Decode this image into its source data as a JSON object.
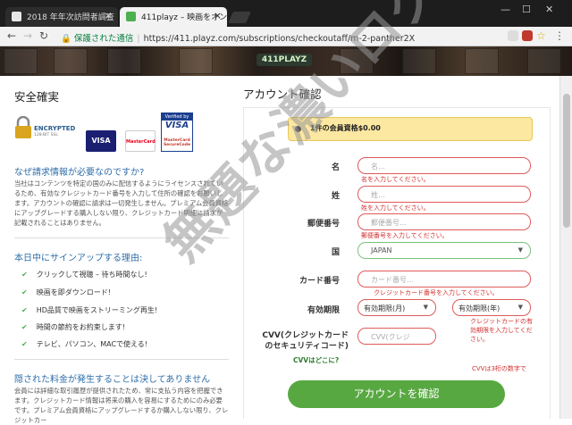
{
  "browser": {
    "tabs": [
      {
        "label": "2018 年年次訪問者調査"
      },
      {
        "label": "411playz – 映画をオンライン"
      }
    ],
    "address": {
      "secure_label": "保護された通信",
      "url": "https://411.playz.com/subscriptions/checkoutaff/m-2-panther2X"
    }
  },
  "site": {
    "logo": "411PLAYZ"
  },
  "left": {
    "security_heading": "安全確実",
    "badges": {
      "encrypted": "ENCRYPTED",
      "encrypted_sub": "128-BIT SSL",
      "visa": "VISA",
      "mastercard": "MasterCard",
      "verified_title": "Verified by",
      "verified_brand": "VISA",
      "securecode": "MasterCard SecureCode"
    },
    "why_heading": "なぜ請求情報が必要なのですか?",
    "why_text": "当社はコンテンツを特定の国のみに配信するようにライセンスされているため、有効なクレジットカード番号を入力して住所の確認をお願いします。アカウントの確認に請求は一切発生しません。プレミアム会員資格にアップグレードする購入しない限り、クレジットカード明細に請求が記載されることはありません。",
    "signup_heading": "本日中にサインアップする理由:",
    "features": [
      "クリックして視聴 – 待ち時間なし!",
      "映画を即ダウンロード!",
      "HD品質で映画をストリーミング再生!",
      "時間の節約をお約束します!",
      "テレビ、パソコン、MACで使える!"
    ],
    "hidden_heading": "隠された料金が発生することは決してありません",
    "hidden_text": "会員には詳細な取引履歴が提供されたため、常に支払う内容を把握できます。クレジットカード情報は将来の購入を容易にするためにのみ必要です。プレミアム会員資格にアップグレードするか購入しない限り、クレジットカー"
  },
  "form": {
    "heading": "アカウント確認",
    "plan_label": "1件の会員資格$0.00",
    "fields": {
      "first_name": {
        "label": "名",
        "placeholder": "名…",
        "error": "名を入力してください。"
      },
      "last_name": {
        "label": "姓",
        "placeholder": "姓…",
        "error": "姓を入力してください。"
      },
      "zip": {
        "label": "郵便番号",
        "placeholder": "郵便番号…",
        "error": "郵便番号を入力してください。"
      },
      "country": {
        "label": "国",
        "value": "JAPAN"
      },
      "card": {
        "label": "カード番号",
        "placeholder": "カード番号…",
        "error": "クレジットカード番号を入力してください。"
      },
      "expiry": {
        "label": "有効期限",
        "month": "有効期限(月)",
        "year": "有効期限(年)",
        "error": "クレジットカードの有効期限を入力してください。"
      },
      "cvv": {
        "label_line1": "CVV(クレジットカード",
        "label_line2": "のセキュリティコード)",
        "placeholder": "CVV(クレジ",
        "link": "CVVはどこに?",
        "error": "CVVは3桁の数字で"
      }
    },
    "submit": "アカウントを確認"
  },
  "watermark": "無題な濃いログ",
  "colors": {
    "accent_green": "#58a842",
    "error_red": "#d32f2f",
    "link_blue": "#2f6ea9",
    "plan_yellow": "#fde8a1"
  }
}
